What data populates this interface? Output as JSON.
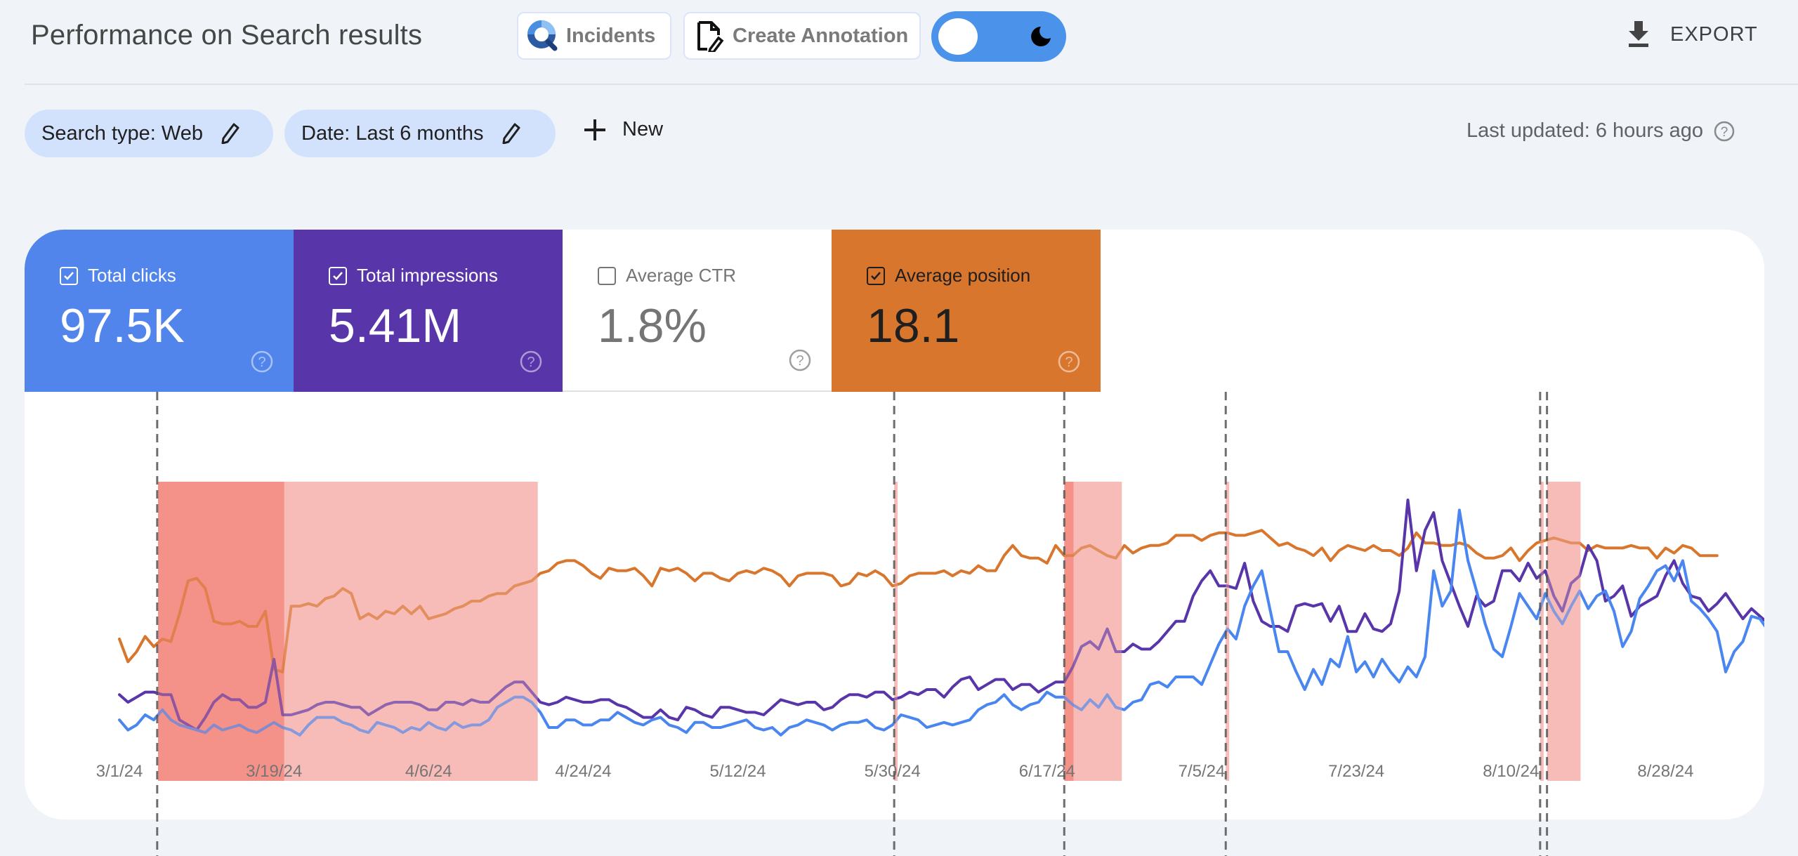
{
  "header": {
    "title": "Performance on Search results",
    "incidents_label": "Incidents",
    "create_annotation_label": "Create Annotation",
    "theme_toggle": {
      "state": "light",
      "icon": "moon-icon"
    },
    "export_label": "EXPORT"
  },
  "filters": {
    "chips": [
      {
        "label": "Search type: Web",
        "icon": "pencil-icon"
      },
      {
        "label": "Date: Last 6 months",
        "icon": "pencil-icon"
      }
    ],
    "new_label": "New",
    "last_updated": "Last updated: 6 hours ago"
  },
  "metrics": [
    {
      "label": "Total clicks",
      "value": "97.5K",
      "checked": true,
      "color": "#5185ec"
    },
    {
      "label": "Total impressions",
      "value": "5.41M",
      "checked": true,
      "color": "#5935aa"
    },
    {
      "label": "Average CTR",
      "value": "1.8%",
      "checked": false,
      "color": "#ffffff"
    },
    {
      "label": "Average position",
      "value": "18.1",
      "checked": true,
      "color": "#d8762e"
    }
  ],
  "chart_data": {
    "type": "line",
    "title": "",
    "xlabel": "",
    "ylabel": "",
    "y_scale_note": "No y-axis shown; values are relative levels (0=bottom, 100=top of plotted band)",
    "x_start": "3/1/24",
    "x_end_days": 183,
    "x_ticks": [
      "3/1/24",
      "3/19/24",
      "4/6/24",
      "4/24/24",
      "5/12/24",
      "5/30/24",
      "6/17/24",
      "7/5/24",
      "7/23/24",
      "8/10/24",
      "8/28/24"
    ],
    "x_tick_days": [
      0,
      18,
      36,
      54,
      72,
      90,
      108,
      126,
      144,
      162,
      180
    ],
    "grid": false,
    "legend": "none",
    "series": [
      {
        "name": "Average position",
        "color": "#d8762e",
        "values": [
          25,
          16,
          20,
          26,
          22,
          25,
          24,
          35,
          48,
          49,
          45,
          32,
          31,
          31,
          32,
          30,
          30,
          36,
          13,
          12,
          38,
          38,
          39,
          38,
          41,
          42,
          45,
          43,
          33,
          35,
          33,
          36,
          35,
          38,
          35,
          38,
          33,
          34,
          35,
          37,
          38,
          40,
          40,
          42,
          43,
          43,
          46,
          47,
          48,
          51,
          52,
          55,
          56,
          56,
          54,
          51,
          49,
          53,
          52,
          52,
          53,
          50,
          46,
          53,
          52,
          53,
          51,
          48,
          51,
          51,
          49,
          48,
          51,
          52,
          51,
          53,
          52,
          50,
          46,
          50,
          51,
          51,
          51,
          50,
          46,
          47,
          51,
          50,
          52,
          50,
          46,
          47,
          50,
          51,
          51,
          51,
          52,
          50,
          52,
          51,
          54,
          52,
          52,
          58,
          62,
          58,
          57,
          57,
          55,
          62,
          58,
          58,
          61,
          62,
          60,
          58,
          57,
          62,
          59,
          61,
          62,
          62,
          63,
          66,
          66,
          66,
          64,
          66,
          67,
          67,
          66,
          66,
          67,
          68,
          65,
          62,
          63,
          61,
          60,
          58,
          61,
          56,
          60,
          62,
          61,
          60,
          62,
          60,
          60,
          58,
          61,
          67,
          63,
          63,
          62,
          62,
          63,
          62,
          59,
          57,
          57,
          58,
          61,
          56,
          60,
          63,
          64,
          65,
          64,
          63,
          63,
          60,
          62,
          61,
          61,
          61,
          62,
          61,
          61,
          57,
          61,
          59,
          62,
          61,
          58,
          58,
          58
        ]
      },
      {
        "name": "Total impressions",
        "color": "#5935aa",
        "values": [
          3,
          0,
          2,
          4,
          4,
          3,
          3,
          -7,
          -9,
          -11,
          -6,
          0,
          3,
          1,
          1,
          -2,
          -2,
          0,
          17,
          -5,
          -5,
          -4,
          -3,
          -1,
          0,
          0,
          -1,
          -2,
          -2,
          -5,
          -3,
          -1,
          0,
          0,
          0,
          -1,
          -3,
          -3,
          0,
          0,
          -1,
          1,
          0,
          0,
          3,
          6,
          8,
          8,
          4,
          0,
          -1,
          0,
          2,
          1,
          0,
          0,
          1,
          1,
          -1,
          -2,
          -4,
          -6,
          -6,
          -3,
          -6,
          -7,
          -2,
          -3,
          -5,
          -6,
          -2,
          -2,
          -3,
          -4,
          -4,
          -5,
          -2,
          1,
          0,
          -1,
          0,
          0,
          -3,
          -2,
          1,
          3,
          3,
          2,
          4,
          4,
          1,
          2,
          4,
          3,
          5,
          5,
          2,
          6,
          9,
          10,
          5,
          7,
          9,
          9,
          5,
          7,
          7,
          4,
          6,
          8,
          8,
          14,
          22,
          24,
          21,
          29,
          20,
          20,
          23,
          21,
          21,
          24,
          28,
          32,
          32,
          42,
          48,
          52,
          46,
          46,
          45,
          55,
          40,
          32,
          30,
          30,
          28,
          38,
          39,
          38,
          39,
          32,
          38,
          28,
          28,
          35,
          29,
          28,
          31,
          44,
          80,
          52,
          68,
          75,
          56,
          47,
          38,
          30,
          42,
          38,
          40,
          52,
          52,
          48,
          55,
          49,
          52,
          42,
          36,
          47,
          50,
          62,
          56,
          40,
          42,
          46,
          34,
          38,
          40,
          42,
          50,
          56,
          47,
          42,
          41,
          36,
          39,
          43,
          38,
          33,
          37,
          34,
          31,
          30,
          38,
          40,
          28
        ]
      },
      {
        "name": "Total clicks",
        "color": "#4a86f0",
        "values": [
          -7,
          -11,
          -9,
          -5,
          -7,
          -3,
          -7,
          -9,
          -10,
          -11,
          -12,
          -9,
          -11,
          -10,
          -9,
          -11,
          -12,
          -10,
          -8,
          -10,
          -11,
          -13,
          -9,
          -6,
          -6,
          -6,
          -8,
          -9,
          -11,
          -12,
          -8,
          -9,
          -10,
          -12,
          -10,
          -11,
          -8,
          -10,
          -11,
          -8,
          -10,
          -9,
          -9,
          -7,
          -2,
          0,
          2,
          2,
          0,
          -4,
          -10,
          -10,
          -7,
          -7,
          -9,
          -9,
          -7,
          -7,
          -4,
          -6,
          -8,
          -9,
          -7,
          -6,
          -9,
          -10,
          -12,
          -8,
          -8,
          -10,
          -10,
          -9,
          -8,
          -7,
          -10,
          -11,
          -10,
          -13,
          -10,
          -9,
          -7,
          -8,
          -9,
          -11,
          -9,
          -8,
          -8,
          -7,
          -10,
          -11,
          -9,
          -5,
          -6,
          -7,
          -10,
          -9,
          -8,
          -9,
          -8,
          -7,
          -3,
          -1,
          0,
          3,
          -1,
          -3,
          -1,
          0,
          4,
          2,
          2,
          -1,
          -3,
          1,
          -2,
          3,
          -2,
          -3,
          0,
          1,
          7,
          8,
          6,
          10,
          10,
          10,
          7,
          15,
          23,
          29,
          25,
          38,
          46,
          52,
          36,
          20,
          20,
          12,
          5,
          13,
          7,
          17,
          14,
          26,
          12,
          16,
          10,
          17,
          12,
          8,
          14,
          10,
          18,
          52,
          38,
          44,
          76,
          56,
          44,
          31,
          21,
          18,
          30,
          43,
          38,
          33,
          43,
          36,
          31,
          38,
          44,
          37,
          42,
          44,
          36,
          22,
          28,
          41,
          46,
          52,
          54,
          48,
          56,
          40,
          37,
          33,
          28,
          12,
          20,
          24,
          34,
          33,
          28,
          31,
          25,
          17
        ]
      }
    ],
    "incident_bands": [
      {
        "start_day": 4.5,
        "end_day": 19.2,
        "intensity": "strong"
      },
      {
        "start_day": 19.2,
        "end_day": 48.7,
        "intensity": "light"
      },
      {
        "start_day": 90.2,
        "end_day": 90.6,
        "intensity": "light"
      },
      {
        "start_day": 110,
        "end_day": 111.1,
        "intensity": "strong"
      },
      {
        "start_day": 111.1,
        "end_day": 116.7,
        "intensity": "light"
      },
      {
        "start_day": 128.8,
        "end_day": 129.2,
        "intensity": "light"
      },
      {
        "start_day": 165.4,
        "end_day": 165.8,
        "intensity": "light"
      },
      {
        "start_day": 166.2,
        "end_day": 170.1,
        "intensity": "light"
      }
    ],
    "annotation_days": [
      4.4,
      90.2,
      110,
      128.8,
      165.4,
      166.2
    ]
  }
}
